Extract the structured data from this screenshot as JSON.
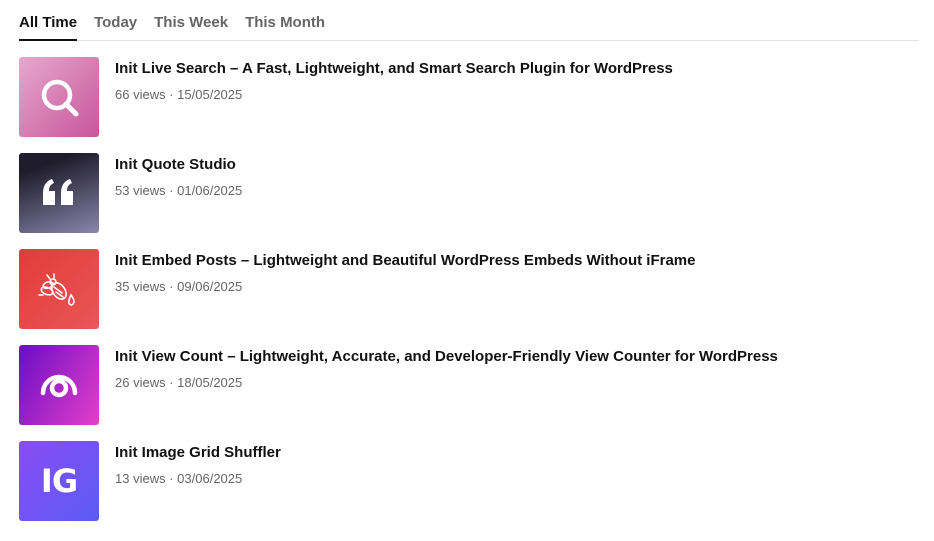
{
  "tabs": [
    {
      "label": "All Time",
      "active": true
    },
    {
      "label": "Today",
      "active": false
    },
    {
      "label": "This Week",
      "active": false
    },
    {
      "label": "This Month",
      "active": false
    }
  ],
  "posts": [
    {
      "title": "Init Live Search – A Fast, Lightweight, and Smart Search Plugin for WordPress",
      "views": "66 views",
      "separator": "·",
      "date": "15/05/2025",
      "icon": "search-icon",
      "colors": [
        "#e6a8ce",
        "#c8559b"
      ]
    },
    {
      "title": "Init Quote Studio",
      "views": "53 views",
      "separator": "·",
      "date": "01/06/2025",
      "icon": "quote-icon",
      "colors": [
        "#1f1d2b",
        "#8a86ad"
      ]
    },
    {
      "title": "Init Embed Posts – Lightweight and Beautiful WordPress Embeds Without iFrame",
      "views": "35 views",
      "separator": "·",
      "date": "09/06/2025",
      "icon": "bee-icon",
      "colors": [
        "#e23b3b",
        "#ea5656"
      ]
    },
    {
      "title": "Init View Count – Lightweight, Accurate, and Developer-Friendly View Counter for WordPress",
      "views": "26 views",
      "separator": "·",
      "date": "18/05/2025",
      "icon": "eye-icon",
      "colors": [
        "#6a0dc4",
        "#e43fc9"
      ]
    },
    {
      "title": "Init Image Grid Shuffler",
      "views": "13 views",
      "separator": "·",
      "date": "03/06/2025",
      "icon": "ig-logo-icon",
      "icon_text": "IG",
      "colors": [
        "#8a4cf2",
        "#5a5cf4"
      ]
    }
  ]
}
